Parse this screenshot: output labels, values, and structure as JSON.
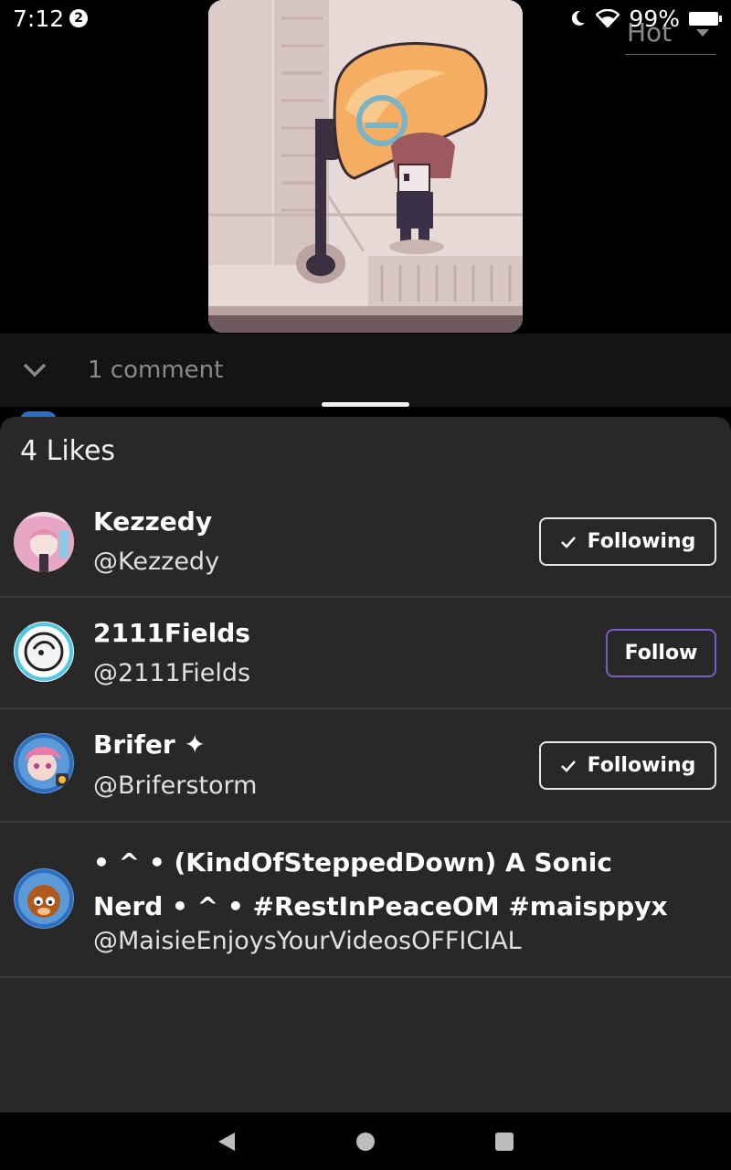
{
  "status": {
    "time": "7:12",
    "notification_count": "2",
    "battery": "99%"
  },
  "comments": {
    "count_label": "1 comment",
    "sort_label": "Hot"
  },
  "likes_sheet": {
    "title": "4 Likes",
    "users": [
      {
        "name": "Kezzedy",
        "handle": "@Kezzedy",
        "button": "Following"
      },
      {
        "name": "2111Fields",
        "handle": "@2111Fields",
        "button": "Follow"
      },
      {
        "name": "Brifer ✦",
        "handle": "@Briferstorm",
        "button": "Following"
      },
      {
        "name": "• ^ • (KindOfSteppedDown) A Sonic Nerd • ^ • #RestInPeaceOM #maisppyx",
        "handle": "@MaisieEnjoysYourVideosOFFICIAL"
      }
    ]
  },
  "colors": {
    "sheet_bg": "#282828",
    "follow_accent": "#7a5cc4"
  },
  "icons": [
    "chevron-down-icon",
    "dropdown-arrow-icon",
    "moon-icon",
    "wifi-icon",
    "battery-icon",
    "check-icon",
    "back-icon",
    "home-icon",
    "recents-icon"
  ]
}
